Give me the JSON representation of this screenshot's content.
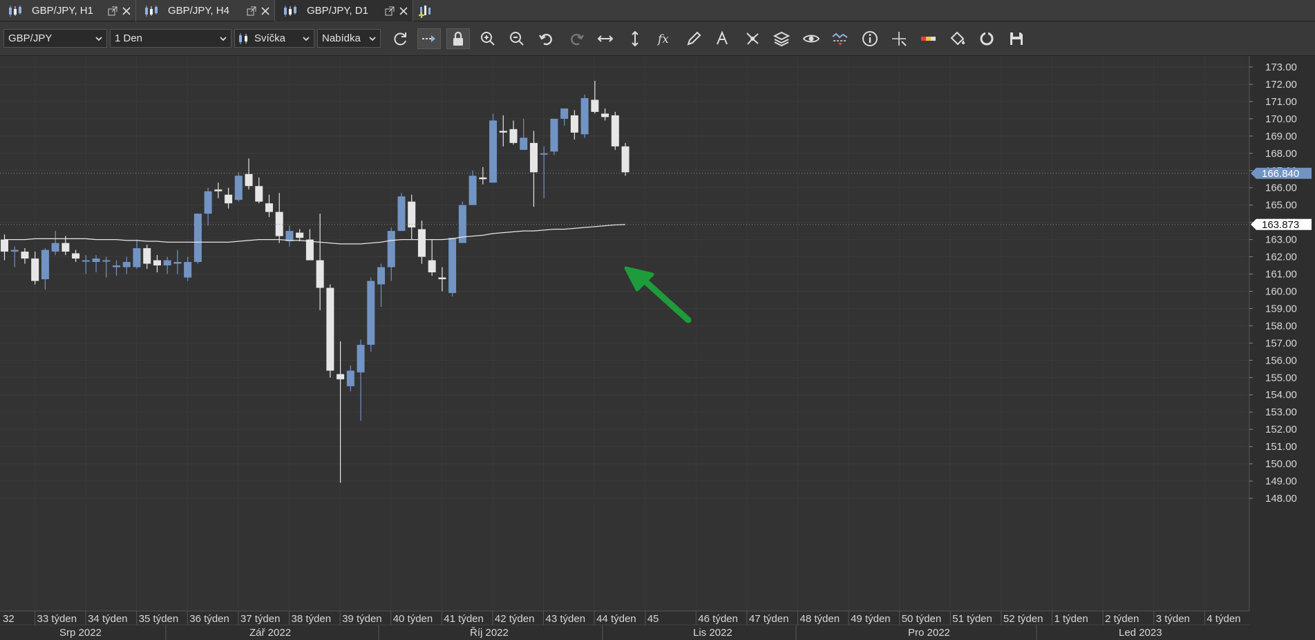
{
  "tabs": [
    {
      "label": "GBP/JPY, H1",
      "active": false
    },
    {
      "label": "GBP/JPY, H4",
      "active": false
    },
    {
      "label": "GBP/JPY, D1",
      "active": true
    }
  ],
  "toolbar": {
    "symbol": "GBP/JPY",
    "period": "1 Den",
    "chart_type": "Svíčka",
    "price_side": "Nabídka"
  },
  "colors": {
    "bull": "#7294c4",
    "bear": "#e6e6e6",
    "ma_line": "#e8e8e8",
    "arrow": "#1e9b3a",
    "current_price_tag": "#7294c4"
  },
  "chart_data": {
    "type": "candlestick",
    "instrument": "GBP/JPY",
    "timeframe": "D1",
    "ylim": [
      147.5,
      173.5
    ],
    "y_ticks": [
      "173.00",
      "172.00",
      "171.00",
      "170.00",
      "169.00",
      "168.00",
      "167.00",
      "166.00",
      "165.00",
      "164.00",
      "163.00",
      "162.00",
      "161.00",
      "160.00",
      "159.00",
      "158.00",
      "157.00",
      "156.00",
      "155.00",
      "154.00",
      "153.00",
      "152.00",
      "151.00",
      "150.00",
      "149.00",
      "148.00"
    ],
    "current_price_label": "166.840",
    "current_price": 166.84,
    "ma_value_label": "163.873",
    "ma_value": 163.873,
    "week_labels": [
      "32",
      "33 týden",
      "34 týden",
      "35 týden",
      "36 týden",
      "37 týden",
      "38 týden",
      "39 týden",
      "40 týden",
      "41 týden",
      "42 týden",
      "43 týden",
      "44 týden",
      "45",
      "46 týden",
      "47 týden",
      "48 týden",
      "49 týden",
      "50 týden",
      "51 týden",
      "52 týden",
      "1 týden",
      "2 týden",
      "3 týden",
      "4 týden"
    ],
    "month_labels": [
      "Srp 2022",
      "Zář 2022",
      "Říj 2022",
      "Lis 2022",
      "Pro 2022",
      "Led 2023"
    ],
    "candles": [
      [
        163.0,
        163.3,
        161.8,
        162.3
      ],
      [
        162.3,
        162.6,
        161.4,
        162.4
      ],
      [
        162.3,
        162.5,
        161.6,
        161.9
      ],
      [
        161.9,
        162.3,
        160.4,
        160.6
      ],
      [
        160.7,
        162.5,
        160.1,
        162.4
      ],
      [
        162.3,
        163.5,
        162.1,
        162.8
      ],
      [
        162.8,
        163.2,
        162.1,
        162.3
      ],
      [
        162.2,
        162.4,
        161.7,
        161.9
      ],
      [
        161.8,
        162.1,
        161.0,
        161.8
      ],
      [
        161.7,
        162.1,
        161.1,
        161.9
      ],
      [
        161.8,
        162.0,
        160.8,
        161.8
      ],
      [
        161.4,
        161.8,
        160.9,
        161.5
      ],
      [
        161.4,
        162.0,
        161.0,
        161.7
      ],
      [
        161.4,
        163.0,
        161.3,
        162.5
      ],
      [
        162.5,
        162.7,
        161.3,
        161.6
      ],
      [
        161.8,
        162.1,
        161.1,
        161.5
      ],
      [
        161.5,
        162.0,
        161.0,
        161.8
      ],
      [
        161.6,
        162.4,
        161.0,
        161.7
      ],
      [
        160.8,
        162.0,
        160.6,
        161.7
      ],
      [
        161.7,
        164.5,
        161.6,
        164.5
      ],
      [
        164.5,
        166.0,
        163.8,
        165.8
      ],
      [
        165.9,
        166.3,
        165.4,
        165.8
      ],
      [
        165.6,
        166.0,
        164.8,
        165.1
      ],
      [
        165.3,
        166.9,
        165.2,
        166.7
      ],
      [
        166.8,
        167.7,
        165.9,
        166.1
      ],
      [
        166.1,
        166.6,
        165.1,
        165.2
      ],
      [
        165.1,
        165.6,
        164.3,
        164.6
      ],
      [
        164.6,
        165.7,
        162.8,
        163.2
      ],
      [
        162.9,
        163.8,
        162.6,
        163.5
      ],
      [
        163.4,
        163.6,
        162.9,
        163.1
      ],
      [
        163.0,
        163.6,
        161.8,
        161.8
      ],
      [
        161.8,
        164.5,
        158.9,
        160.2
      ],
      [
        160.2,
        160.4,
        155.0,
        155.4
      ],
      [
        155.2,
        157.1,
        148.9,
        154.9
      ],
      [
        154.5,
        155.7,
        154.2,
        155.4
      ],
      [
        155.3,
        157.2,
        152.5,
        156.9
      ],
      [
        156.9,
        160.8,
        156.5,
        160.6
      ],
      [
        160.4,
        161.6,
        159.1,
        161.4
      ],
      [
        161.4,
        163.7,
        160.6,
        163.5
      ],
      [
        163.5,
        165.7,
        163.5,
        165.5
      ],
      [
        165.2,
        165.6,
        163.0,
        163.7
      ],
      [
        163.6,
        164.1,
        161.6,
        162.0
      ],
      [
        161.8,
        163.0,
        160.9,
        161.1
      ],
      [
        160.8,
        161.4,
        160.0,
        160.7
      ],
      [
        159.9,
        163.1,
        159.7,
        163.1
      ],
      [
        162.8,
        165.2,
        162.9,
        165.0
      ],
      [
        165.0,
        167.0,
        165.1,
        166.7
      ],
      [
        166.6,
        167.2,
        166.2,
        166.5
      ],
      [
        166.3,
        170.3,
        166.3,
        169.9
      ],
      [
        169.3,
        170.2,
        168.4,
        169.2
      ],
      [
        169.4,
        169.9,
        168.5,
        168.6
      ],
      [
        168.2,
        170.0,
        168.2,
        168.9
      ],
      [
        168.6,
        169.3,
        164.9,
        166.9
      ],
      [
        168.0,
        168.4,
        165.4,
        168.0
      ],
      [
        168.1,
        170.0,
        167.9,
        170.0
      ],
      [
        170.0,
        170.3,
        169.6,
        170.6
      ],
      [
        170.2,
        170.5,
        168.8,
        169.2
      ],
      [
        169.1,
        171.4,
        168.9,
        171.2
      ],
      [
        171.1,
        172.2,
        170.3,
        170.4
      ],
      [
        170.3,
        170.6,
        169.9,
        170.1
      ],
      [
        170.2,
        170.4,
        168.2,
        168.4
      ],
      [
        168.4,
        168.6,
        166.7,
        166.9
      ]
    ],
    "ma": [
      163.0,
      163.0,
      163.0,
      163.05,
      163.05,
      163.05,
      163.05,
      163.05,
      163.05,
      163.0,
      163.0,
      163.0,
      162.95,
      162.95,
      162.9,
      162.9,
      162.85,
      162.85,
      162.85,
      162.85,
      162.85,
      162.85,
      162.85,
      162.9,
      162.95,
      163.0,
      163.0,
      163.0,
      162.95,
      162.95,
      162.9,
      162.85,
      162.8,
      162.75,
      162.75,
      162.75,
      162.8,
      162.85,
      162.95,
      163.0,
      163.0,
      163.0,
      163.0,
      163.0,
      163.05,
      163.15,
      163.2,
      163.25,
      163.35,
      163.4,
      163.45,
      163.5,
      163.5,
      163.55,
      163.6,
      163.6,
      163.65,
      163.7,
      163.75,
      163.8,
      163.85,
      163.873
    ]
  }
}
